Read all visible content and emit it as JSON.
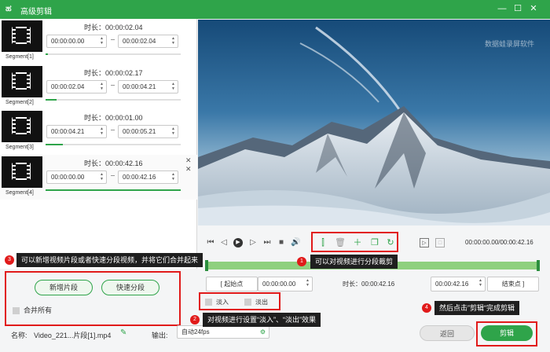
{
  "window": {
    "logo": "ಹ",
    "title": "高级剪辑",
    "controls": {
      "minimize": "—",
      "maximize": "☐",
      "close": "✕"
    }
  },
  "segments": [
    {
      "label": "Segment[1]",
      "duration": "时长：00:00:02.04",
      "start": "00:00:00.00",
      "end": "00:00:02.04",
      "progress": 0.02
    },
    {
      "label": "Segment[2]",
      "duration": "时长：00:00:02.17",
      "start": "00:00:02.04",
      "end": "00:00:04.21",
      "progress": 0.08
    },
    {
      "label": "Segment[3]",
      "duration": "时长：00:00:01.00",
      "start": "00:00:04.21",
      "end": "00:00:05.21",
      "progress": 0.13
    },
    {
      "label": "Segment[4]",
      "duration": "时长：00:00:42.16",
      "start": "00:00:00.00",
      "end": "00:00:42.16",
      "progress": 1.0
    }
  ],
  "preview": {
    "watermark": "数据蛙录屏软件"
  },
  "player": {
    "timecode": "00:00:00.00/00:00:42.16",
    "icons": [
      "skip-start-icon",
      "prev-frame-icon",
      "play-icon",
      "next-frame-icon",
      "skip-end-icon",
      "stop-icon",
      "volume-icon"
    ],
    "edit_icons": [
      "split-icon",
      "delete-icon",
      "add-icon",
      "copy-icon",
      "reset-icon"
    ],
    "extra_icons": [
      "mark-in-icon",
      "mark-out-icon"
    ]
  },
  "trim": {
    "start_label": "起始点",
    "start_value": "00:00:00.00",
    "duration": "时长：00:00:42.16",
    "end_value": "00:00:42.16",
    "end_label": "结束点"
  },
  "fade": {
    "in_label": "淡入",
    "out_label": "淡出"
  },
  "segment_actions": {
    "add_label": "新增片段",
    "quick_split_label": "快速分段",
    "merge_all_label": "合并所有"
  },
  "footer": {
    "name_label": "名称:",
    "name_value": "Video_221...片段[1].mp4",
    "output_label": "输出:",
    "output_value": "自动24fps",
    "back_label": "返回",
    "cut_label": "剪辑"
  },
  "callouts": [
    {
      "number": "1",
      "text": "可以对视频进行分段裁剪"
    },
    {
      "number": "2",
      "text": "对视频进行设置“淡入”、“淡出”效果"
    },
    {
      "number": "3",
      "text": "可以新增视频片段或者快速分段视频，并将它们合并起来"
    },
    {
      "number": "4",
      "text": "然后点击”剪辑“完成剪辑"
    }
  ],
  "colors": {
    "accent": "#2fa44a",
    "highlight": "#e11a1a",
    "callout_bg": "#1f1f1f"
  }
}
